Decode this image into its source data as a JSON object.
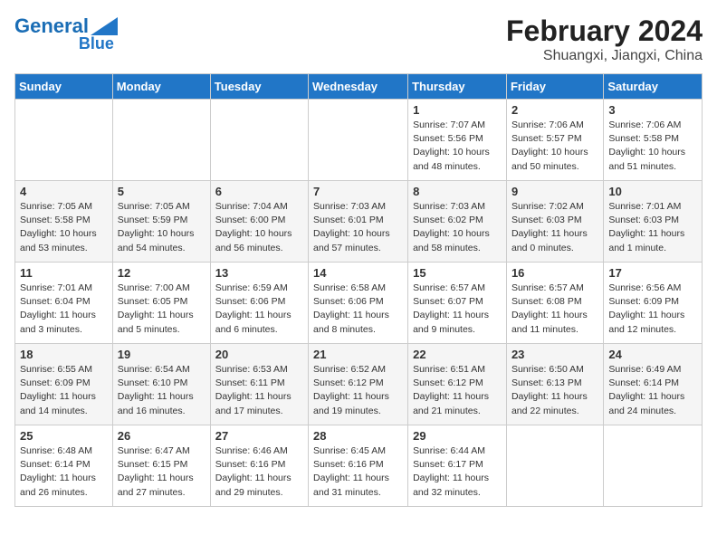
{
  "header": {
    "logo_line1": "General",
    "logo_line2": "Blue",
    "month_year": "February 2024",
    "location": "Shuangxi, Jiangxi, China"
  },
  "weekdays": [
    "Sunday",
    "Monday",
    "Tuesday",
    "Wednesday",
    "Thursday",
    "Friday",
    "Saturday"
  ],
  "weeks": [
    [
      {
        "day": "",
        "info": ""
      },
      {
        "day": "",
        "info": ""
      },
      {
        "day": "",
        "info": ""
      },
      {
        "day": "",
        "info": ""
      },
      {
        "day": "1",
        "info": "Sunrise: 7:07 AM\nSunset: 5:56 PM\nDaylight: 10 hours and 48 minutes."
      },
      {
        "day": "2",
        "info": "Sunrise: 7:06 AM\nSunset: 5:57 PM\nDaylight: 10 hours and 50 minutes."
      },
      {
        "day": "3",
        "info": "Sunrise: 7:06 AM\nSunset: 5:58 PM\nDaylight: 10 hours and 51 minutes."
      }
    ],
    [
      {
        "day": "4",
        "info": "Sunrise: 7:05 AM\nSunset: 5:58 PM\nDaylight: 10 hours and 53 minutes."
      },
      {
        "day": "5",
        "info": "Sunrise: 7:05 AM\nSunset: 5:59 PM\nDaylight: 10 hours and 54 minutes."
      },
      {
        "day": "6",
        "info": "Sunrise: 7:04 AM\nSunset: 6:00 PM\nDaylight: 10 hours and 56 minutes."
      },
      {
        "day": "7",
        "info": "Sunrise: 7:03 AM\nSunset: 6:01 PM\nDaylight: 10 hours and 57 minutes."
      },
      {
        "day": "8",
        "info": "Sunrise: 7:03 AM\nSunset: 6:02 PM\nDaylight: 10 hours and 58 minutes."
      },
      {
        "day": "9",
        "info": "Sunrise: 7:02 AM\nSunset: 6:03 PM\nDaylight: 11 hours and 0 minutes."
      },
      {
        "day": "10",
        "info": "Sunrise: 7:01 AM\nSunset: 6:03 PM\nDaylight: 11 hours and 1 minute."
      }
    ],
    [
      {
        "day": "11",
        "info": "Sunrise: 7:01 AM\nSunset: 6:04 PM\nDaylight: 11 hours and 3 minutes."
      },
      {
        "day": "12",
        "info": "Sunrise: 7:00 AM\nSunset: 6:05 PM\nDaylight: 11 hours and 5 minutes."
      },
      {
        "day": "13",
        "info": "Sunrise: 6:59 AM\nSunset: 6:06 PM\nDaylight: 11 hours and 6 minutes."
      },
      {
        "day": "14",
        "info": "Sunrise: 6:58 AM\nSunset: 6:06 PM\nDaylight: 11 hours and 8 minutes."
      },
      {
        "day": "15",
        "info": "Sunrise: 6:57 AM\nSunset: 6:07 PM\nDaylight: 11 hours and 9 minutes."
      },
      {
        "day": "16",
        "info": "Sunrise: 6:57 AM\nSunset: 6:08 PM\nDaylight: 11 hours and 11 minutes."
      },
      {
        "day": "17",
        "info": "Sunrise: 6:56 AM\nSunset: 6:09 PM\nDaylight: 11 hours and 12 minutes."
      }
    ],
    [
      {
        "day": "18",
        "info": "Sunrise: 6:55 AM\nSunset: 6:09 PM\nDaylight: 11 hours and 14 minutes."
      },
      {
        "day": "19",
        "info": "Sunrise: 6:54 AM\nSunset: 6:10 PM\nDaylight: 11 hours and 16 minutes."
      },
      {
        "day": "20",
        "info": "Sunrise: 6:53 AM\nSunset: 6:11 PM\nDaylight: 11 hours and 17 minutes."
      },
      {
        "day": "21",
        "info": "Sunrise: 6:52 AM\nSunset: 6:12 PM\nDaylight: 11 hours and 19 minutes."
      },
      {
        "day": "22",
        "info": "Sunrise: 6:51 AM\nSunset: 6:12 PM\nDaylight: 11 hours and 21 minutes."
      },
      {
        "day": "23",
        "info": "Sunrise: 6:50 AM\nSunset: 6:13 PM\nDaylight: 11 hours and 22 minutes."
      },
      {
        "day": "24",
        "info": "Sunrise: 6:49 AM\nSunset: 6:14 PM\nDaylight: 11 hours and 24 minutes."
      }
    ],
    [
      {
        "day": "25",
        "info": "Sunrise: 6:48 AM\nSunset: 6:14 PM\nDaylight: 11 hours and 26 minutes."
      },
      {
        "day": "26",
        "info": "Sunrise: 6:47 AM\nSunset: 6:15 PM\nDaylight: 11 hours and 27 minutes."
      },
      {
        "day": "27",
        "info": "Sunrise: 6:46 AM\nSunset: 6:16 PM\nDaylight: 11 hours and 29 minutes."
      },
      {
        "day": "28",
        "info": "Sunrise: 6:45 AM\nSunset: 6:16 PM\nDaylight: 11 hours and 31 minutes."
      },
      {
        "day": "29",
        "info": "Sunrise: 6:44 AM\nSunset: 6:17 PM\nDaylight: 11 hours and 32 minutes."
      },
      {
        "day": "",
        "info": ""
      },
      {
        "day": "",
        "info": ""
      }
    ]
  ]
}
